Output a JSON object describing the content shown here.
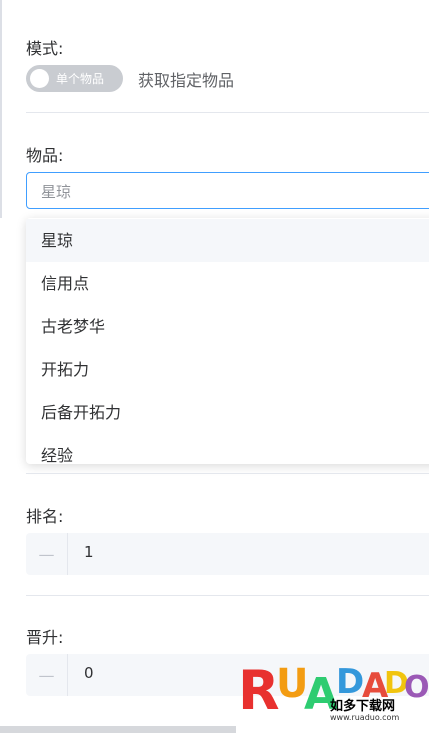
{
  "mode": {
    "label": "模式:",
    "toggle_text": "单个物品",
    "toggle_desc": "获取指定物品"
  },
  "item": {
    "label": "物品:",
    "value": "星琼",
    "options": [
      "星琼",
      "信用点",
      "古老梦华",
      "开拓力",
      "后备开拓力",
      "经验"
    ]
  },
  "rank": {
    "label": "排名:",
    "value": "1"
  },
  "promotion": {
    "label": "晋升:",
    "value": "0"
  },
  "watermark": {
    "letters": "RUADADO",
    "site_name": "如多下载网",
    "url": "www.ruaduo.com"
  }
}
